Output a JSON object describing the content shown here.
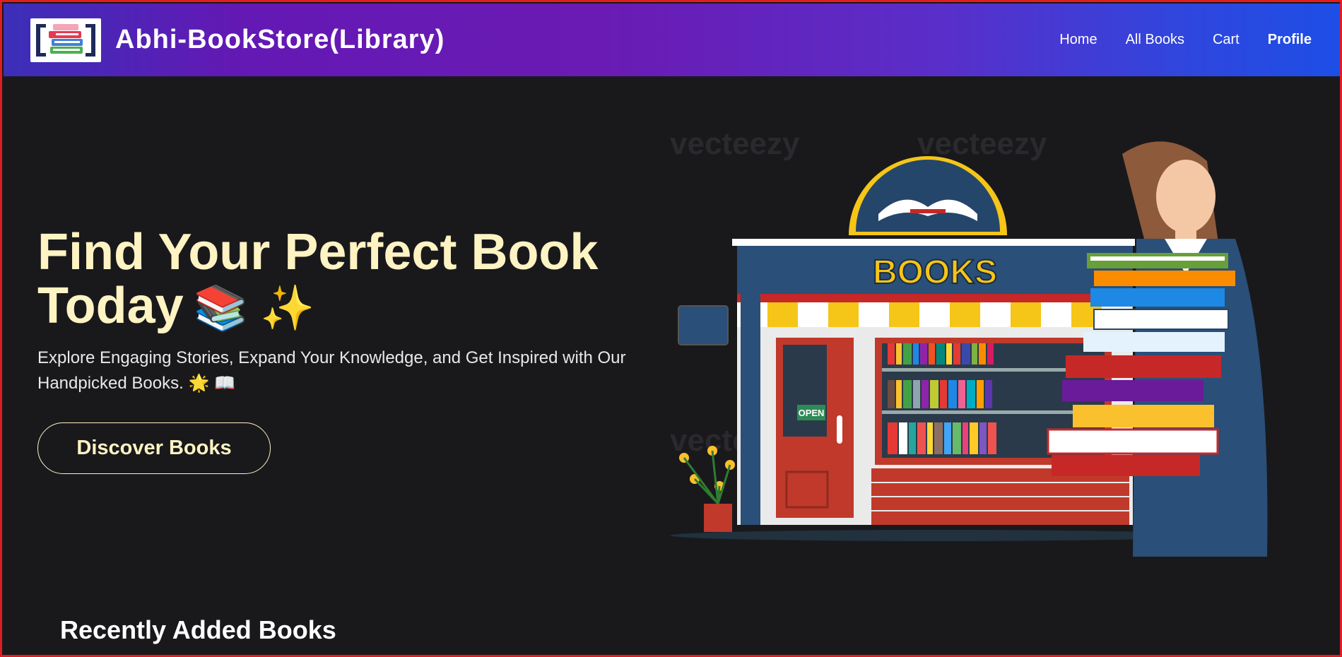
{
  "header": {
    "logo_icon": "books-stack-icon",
    "title": "Abhi-BookStore(Library)",
    "nav": [
      {
        "label": "Home"
      },
      {
        "label": "All Books"
      },
      {
        "label": "Cart"
      },
      {
        "label": "Profile"
      }
    ]
  },
  "hero": {
    "title": "Find Your Perfect Book Today",
    "title_emoji": "📚 ✨",
    "subtitle_line1": "Explore Engaging Stories, Expand Your Knowledge, and Get Inspired with Our",
    "subtitle_line2": "Handpicked Books. 🌟 📖",
    "cta_label": "Discover Books",
    "illustration": {
      "sign_text": "BOOKS",
      "door_sign": "OPEN",
      "watermark": "vecteezy"
    }
  },
  "recent": {
    "title": "Recently Added Books"
  },
  "colors": {
    "accent_cream": "#fdf3c3",
    "background": "#19191c",
    "header_purple": "#6a1bb3",
    "header_blue": "#1d4ee6",
    "frame_red": "#e11d24"
  }
}
